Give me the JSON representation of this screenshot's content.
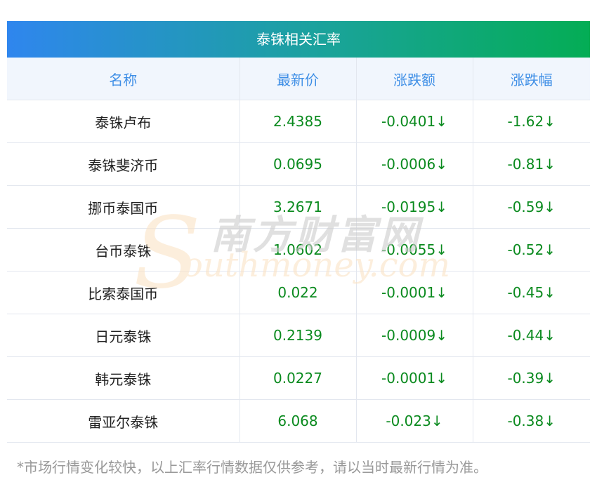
{
  "title": "泰铢相关汇率",
  "headers": [
    "名称",
    "最新价",
    "涨跌额",
    "涨跌幅"
  ],
  "rows": [
    {
      "name": "泰铢卢布",
      "price": "2.4385",
      "change": "-0.0401↓",
      "pct": "-1.62↓"
    },
    {
      "name": "泰铢斐济币",
      "price": "0.0695",
      "change": "-0.0006↓",
      "pct": "-0.81↓"
    },
    {
      "name": "挪币泰国币",
      "price": "3.2671",
      "change": "-0.0195↓",
      "pct": "-0.59↓"
    },
    {
      "name": "台币泰铢",
      "price": "1.0602",
      "change": "-0.0055↓",
      "pct": "-0.52↓"
    },
    {
      "name": "比索泰国币",
      "price": "0.022",
      "change": "-0.0001↓",
      "pct": "-0.45↓"
    },
    {
      "name": "日元泰铢",
      "price": "0.2139",
      "change": "-0.0009↓",
      "pct": "-0.44↓"
    },
    {
      "name": "韩元泰铢",
      "price": "0.0227",
      "change": "-0.0001↓",
      "pct": "-0.39↓"
    },
    {
      "name": "雷亚尔泰铢",
      "price": "6.068",
      "change": "-0.023↓",
      "pct": "-0.38↓"
    }
  ],
  "watermark": {
    "cn": "南方财富网",
    "en": "outhmoney.com",
    "s": "S"
  },
  "note": "*市场行情变化较快，以上汇率行情数据仅供参考，请以当时最新行情为准。"
}
